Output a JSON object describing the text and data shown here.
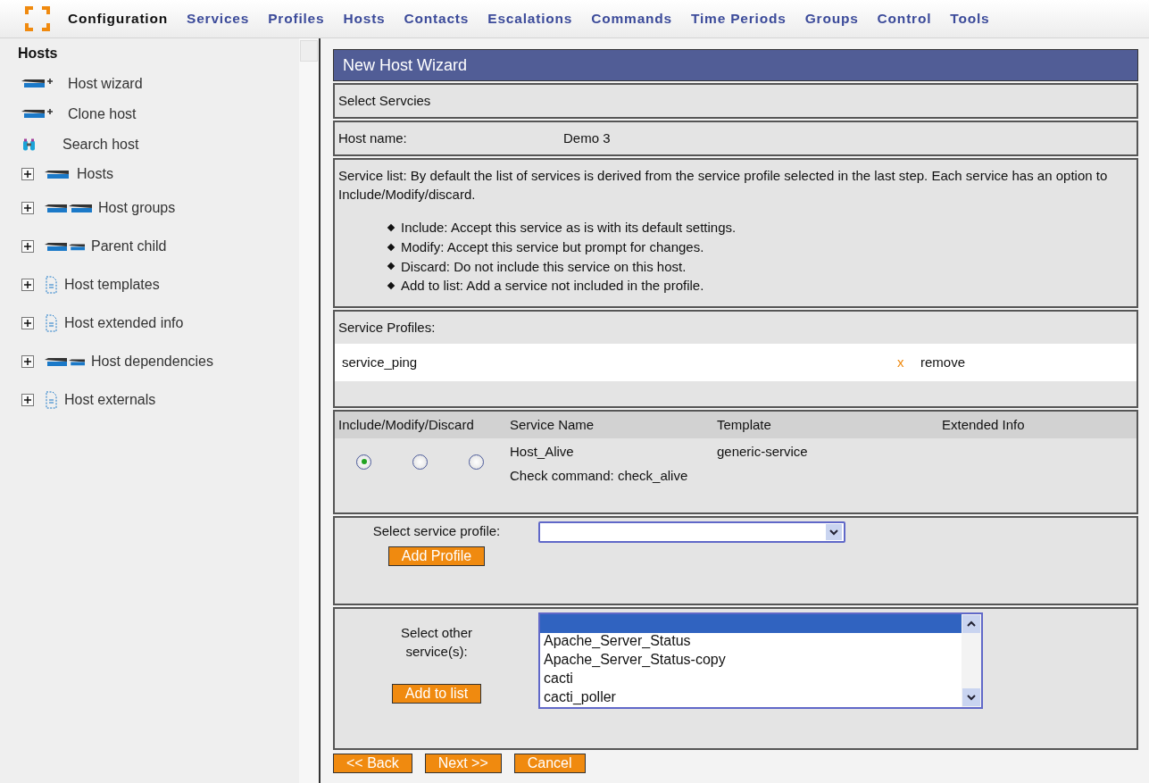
{
  "nav": {
    "items": [
      {
        "label": "Configuration",
        "selected": true
      },
      {
        "label": "Services",
        "selected": false
      },
      {
        "label": "Profiles",
        "selected": false
      },
      {
        "label": "Hosts",
        "selected": false
      },
      {
        "label": "Contacts",
        "selected": false
      },
      {
        "label": "Escalations",
        "selected": false
      },
      {
        "label": "Commands",
        "selected": false
      },
      {
        "label": "Time Periods",
        "selected": false
      },
      {
        "label": "Groups",
        "selected": false
      },
      {
        "label": "Control",
        "selected": false
      },
      {
        "label": "Tools",
        "selected": false
      }
    ]
  },
  "sidebar": {
    "title": "Hosts",
    "actions": [
      {
        "label": "Host wizard",
        "kind": "host_add"
      },
      {
        "label": "Clone host",
        "kind": "host_add"
      },
      {
        "label": "Search host",
        "kind": "search"
      }
    ],
    "tree": [
      {
        "label": "Hosts",
        "kind": "host",
        "expanded": false
      },
      {
        "label": "Host groups",
        "kind": "hosts",
        "expanded": false
      },
      {
        "label": "Parent child",
        "kind": "parent_child",
        "expanded": false
      },
      {
        "label": "Host templates",
        "kind": "doc",
        "expanded": false
      },
      {
        "label": "Host extended info",
        "kind": "doc",
        "expanded": false
      },
      {
        "label": "Host dependencies",
        "kind": "parent_child",
        "expanded": false
      },
      {
        "label": "Host externals",
        "kind": "doc",
        "expanded": false
      }
    ]
  },
  "wizard": {
    "title": "New Host Wizard",
    "step": "Select Servcies",
    "host_name_label": "Host name:",
    "host_name": "Demo 3",
    "intro": "Service list: By default the list of services is derived from the service profile selected in the last step. Each service has an option to Include/Modify/discard.",
    "bullets": [
      "Include: Accept this service as is with its default settings.",
      "Modify: Accept this service but prompt for changes.",
      "Discard: Do not include this service on this host.",
      "Add to list: Add a service not included in the profile."
    ],
    "profiles": {
      "label": "Service Profiles:",
      "items": [
        {
          "name": "service_ping",
          "remove_icon": "x",
          "remove": "remove"
        }
      ]
    },
    "services": {
      "columns": [
        "Include/Modify/Discard",
        "Service Name",
        "Template",
        "Extended Info"
      ],
      "rows": [
        {
          "choices": [
            {
              "selected": true
            },
            {
              "selected": false
            },
            {
              "selected": false
            }
          ],
          "name": "Host_Alive",
          "template": "generic-service",
          "command": "Check command: check_alive"
        }
      ]
    },
    "profile_select": {
      "label": "Select service profile:",
      "button": "Add Profile"
    },
    "other_services": {
      "label": "Select other service(s):",
      "button": "Add to list",
      "blank_row_selected": true,
      "options": [
        "Apache_Server_Status",
        "Apache_Server_Status-copy",
        "cacti",
        "cacti_poller"
      ]
    },
    "buttons": [
      "<< Back",
      "Next >>",
      "Cancel"
    ]
  }
}
